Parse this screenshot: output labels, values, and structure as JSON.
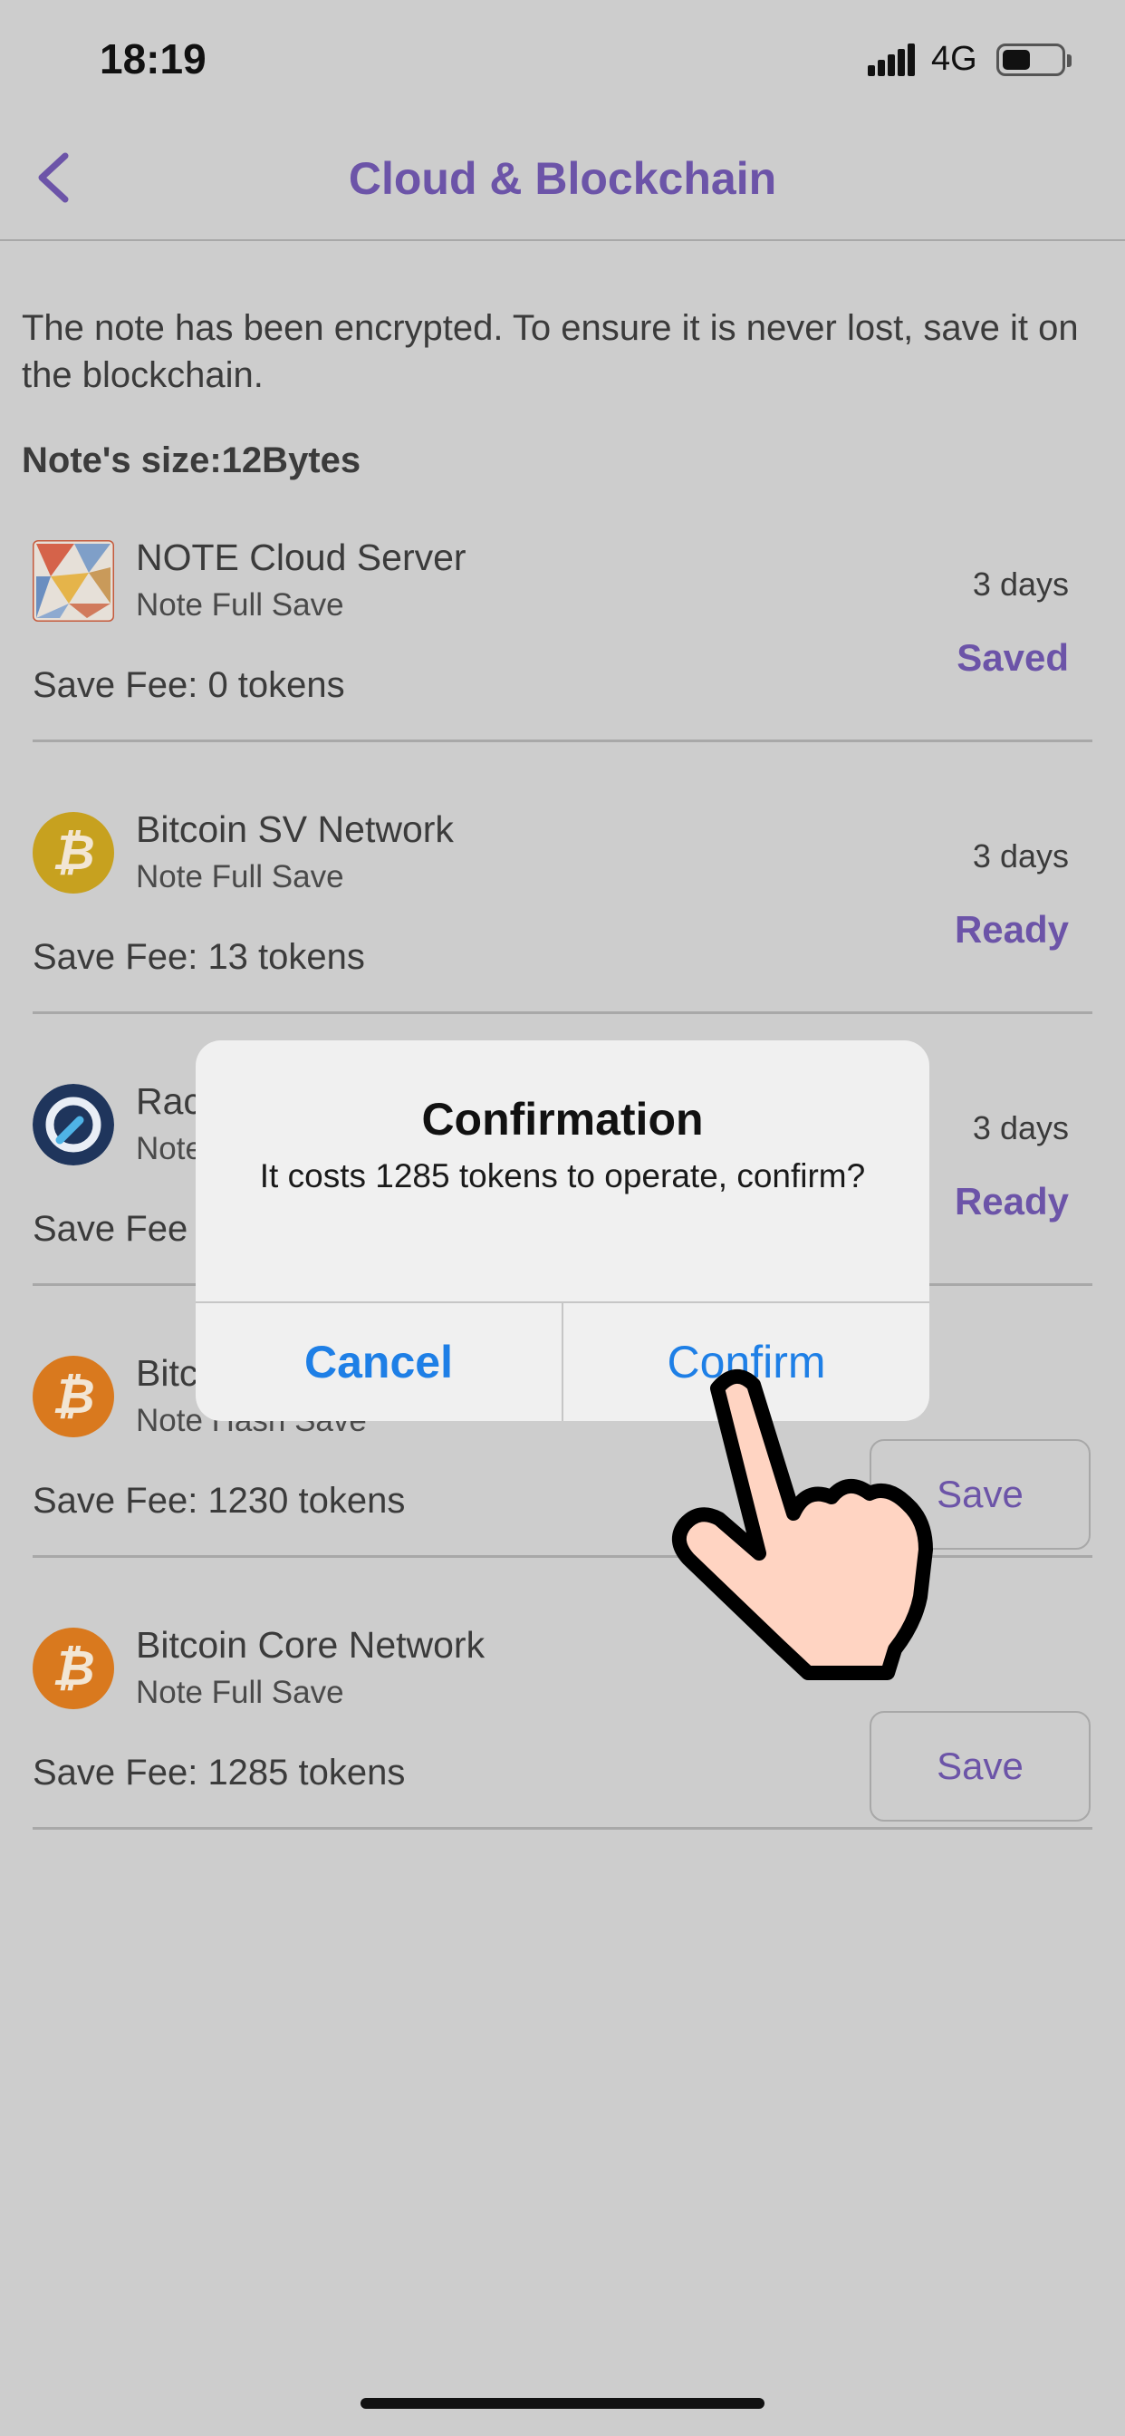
{
  "status_bar": {
    "time": "18:19",
    "network": "4G"
  },
  "nav": {
    "title": "Cloud & Blockchain"
  },
  "intro": "The note has been encrypted. To ensure it is never lost, save it on the blockchain.",
  "note_size": "Note's size:12Bytes",
  "rows": [
    {
      "title": "NOTE Cloud Server",
      "subtitle": "Note Full Save",
      "fee": "Save Fee: 0 tokens",
      "days": "3 days",
      "status": "Saved",
      "icon": "note-cloud-logo-icon"
    },
    {
      "title": "Bitcoin SV Network",
      "subtitle": "Note Full Save",
      "fee": "Save Fee: 13 tokens",
      "days": "3 days",
      "status": "Ready",
      "icon": "bitcoin-sv-icon"
    },
    {
      "title": "Rac",
      "subtitle": "Note",
      "fee": "Save Fee",
      "days": "3 days",
      "status": "Ready",
      "icon": "radiant-icon"
    },
    {
      "title": "Bitc",
      "subtitle": "Note Hash Save",
      "fee": "Save Fee: 1230 tokens",
      "action": "Save",
      "icon": "bitcoin-icon"
    },
    {
      "title": "Bitcoin Core Network",
      "subtitle": "Note Full Save",
      "fee": "Save Fee: 1285 tokens",
      "action": "Save",
      "icon": "bitcoin-icon"
    }
  ],
  "dialog": {
    "title": "Confirmation",
    "message": "It costs 1285 tokens to operate, confirm?",
    "cancel": "Cancel",
    "confirm": "Confirm"
  },
  "colors": {
    "accent": "#6c54a8",
    "link": "#1e7fe6",
    "background": "#cdcdcd"
  }
}
